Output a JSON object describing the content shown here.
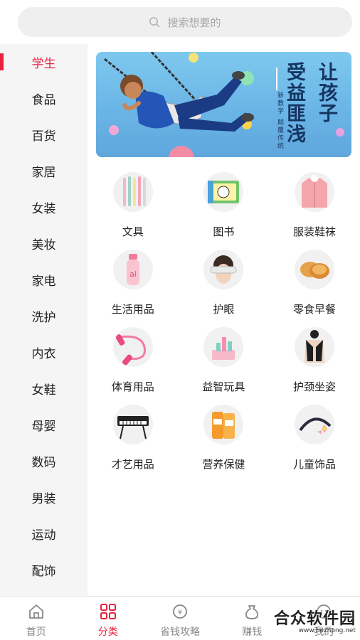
{
  "search": {
    "placeholder": "搜索想要的"
  },
  "sidebar": {
    "items": [
      {
        "label": "学生",
        "active": true
      },
      {
        "label": "食品"
      },
      {
        "label": "百货"
      },
      {
        "label": "家居"
      },
      {
        "label": "女装"
      },
      {
        "label": "美妆"
      },
      {
        "label": "家电"
      },
      {
        "label": "洗护"
      },
      {
        "label": "内衣"
      },
      {
        "label": "女鞋"
      },
      {
        "label": "母婴"
      },
      {
        "label": "数码"
      },
      {
        "label": "男装"
      },
      {
        "label": "运动"
      },
      {
        "label": "配饰"
      }
    ]
  },
  "banner": {
    "title_col1": "让孩子",
    "title_col2": "受益匪浅",
    "subtitle": "新教学 颠覆传统"
  },
  "categories": [
    {
      "label": "文具",
      "icon": "pens-icon"
    },
    {
      "label": "图书",
      "icon": "books-icon"
    },
    {
      "label": "服装鞋袜",
      "icon": "coat-icon"
    },
    {
      "label": "生活用品",
      "icon": "bottle-icon"
    },
    {
      "label": "护眼",
      "icon": "eye-massager-icon"
    },
    {
      "label": "零食早餐",
      "icon": "snack-icon"
    },
    {
      "label": "体育用品",
      "icon": "jump-rope-icon"
    },
    {
      "label": "益智玩具",
      "icon": "toy-blocks-icon"
    },
    {
      "label": "护颈坐姿",
      "icon": "posture-brace-icon"
    },
    {
      "label": "才艺用品",
      "icon": "keyboard-icon"
    },
    {
      "label": "营养保健",
      "icon": "supplement-icon"
    },
    {
      "label": "儿童饰品",
      "icon": "headband-icon"
    }
  ],
  "tabbar": {
    "tabs": [
      {
        "label": "首页",
        "icon": "home-icon"
      },
      {
        "label": "分类",
        "icon": "category-icon",
        "active": true
      },
      {
        "label": "省钱攻略",
        "icon": "coupon-icon"
      },
      {
        "label": "赚钱",
        "icon": "money-bag-icon"
      },
      {
        "label": "我的",
        "icon": "profile-icon"
      }
    ]
  },
  "watermark": {
    "main": "合众软件园",
    "url": "www.hezhong.net"
  },
  "colors": {
    "accent": "#e8233f",
    "sidebar_bg": "#f5f5f5",
    "search_bg": "#efefef"
  }
}
